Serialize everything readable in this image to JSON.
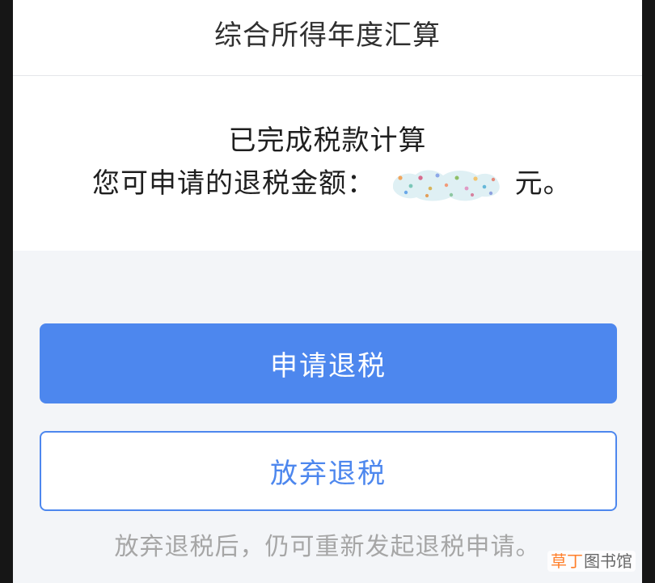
{
  "header": {
    "title": "综合所得年度汇算"
  },
  "result": {
    "status": "已完成税款计算",
    "refund_prefix": "您可申请的退税金额：",
    "refund_suffix": "元。"
  },
  "actions": {
    "apply_refund": "申请退税",
    "abandon_refund": "放弃退税"
  },
  "hint": {
    "text": "放弃退税后，仍可重新发起退税申请。"
  },
  "watermark": {
    "accent": "草丁",
    "rest": "图书馆"
  },
  "colors": {
    "primary": "#4d87ee",
    "background": "#f3f5f8",
    "hint": "#a6a6a6",
    "watermark_accent": "#ff7f2a"
  }
}
